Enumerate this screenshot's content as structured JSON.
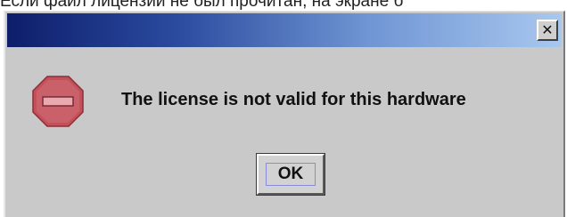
{
  "background_text": "Если файл лицензии не был прочитан, на экране б",
  "dialog": {
    "title": "",
    "close_icon": "close-icon",
    "close_glyph": "✕",
    "icon": "stop-error-icon",
    "message": "The license is not valid for this hardware",
    "ok_label": "OK"
  },
  "colors": {
    "titlebar_start": "#0d1e6a",
    "titlebar_end": "#a9c8ef",
    "dialog_bg": "#c9c9c9",
    "icon_red": "#c4505a"
  }
}
